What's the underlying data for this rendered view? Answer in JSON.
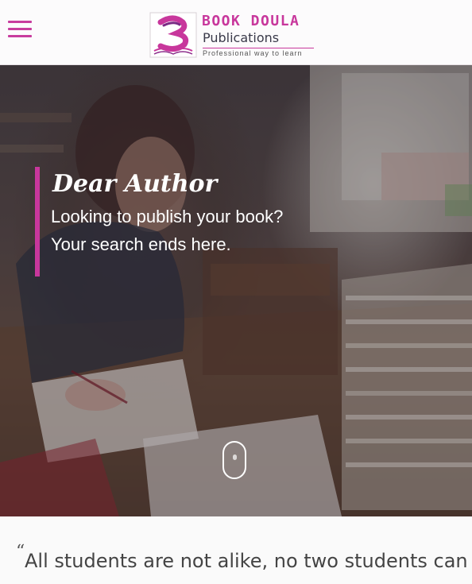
{
  "header": {
    "menu_icon": "hamburger-menu-icon",
    "logo": {
      "icon": "book-doula-logo-icon",
      "title": "BOOK DOULA",
      "subtitle": "Publications",
      "tagline": "Professional way to learn"
    }
  },
  "hero": {
    "heading": "Dear Author",
    "line1": "Looking to publish your book?",
    "line2": "Your search ends here.",
    "scroll_icon": "mouse-scroll-icon"
  },
  "quote": {
    "mark": "“",
    "text": "All students are not alike, no two students can"
  },
  "colors": {
    "accent": "#c8379c",
    "header_bg": "#fcfbfc",
    "quote_text": "#444444"
  }
}
